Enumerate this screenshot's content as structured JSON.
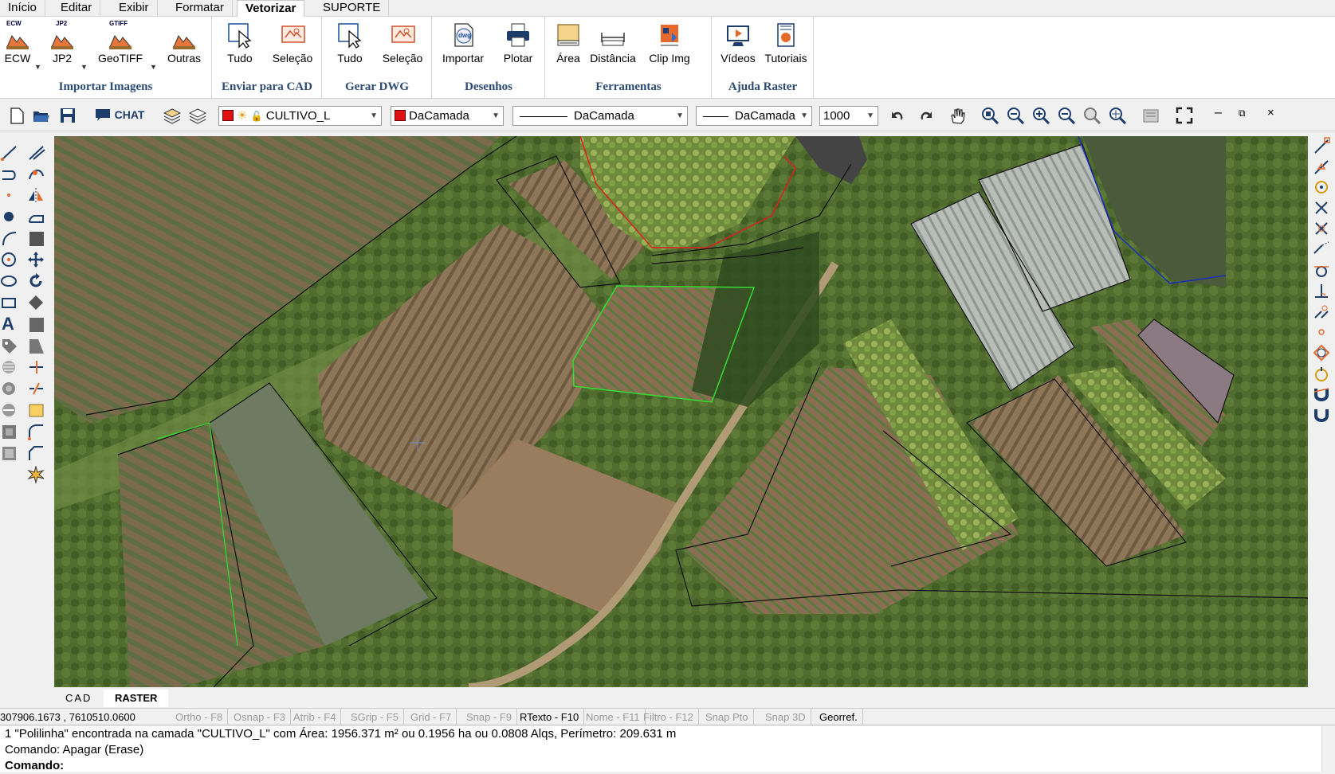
{
  "menu": {
    "tabs": [
      {
        "label": "Início"
      },
      {
        "label": "Editar"
      },
      {
        "label": "Exibir"
      },
      {
        "label": "Formatar"
      },
      {
        "label": "Vetorizar"
      },
      {
        "label": "SUPORTE"
      }
    ],
    "active_tab": "Vetorizar"
  },
  "ribbon": {
    "groups": [
      {
        "title": "Importar Imagens",
        "buttons": [
          {
            "label": "ECW",
            "badge": "ECW",
            "icon": "ecw-import-icon"
          },
          {
            "label": "JP2",
            "badge": "JP2",
            "icon": "jp2-import-icon"
          },
          {
            "label": "GeoTIFF",
            "badge": "GTIFF",
            "icon": "geotiff-import-icon"
          },
          {
            "label": "Outras",
            "icon": "other-image-import-icon"
          }
        ]
      },
      {
        "title": "Enviar para CAD",
        "buttons": [
          {
            "label": "Tudo",
            "icon": "send-all-icon"
          },
          {
            "label": "Seleção",
            "icon": "send-selection-icon"
          }
        ]
      },
      {
        "title": "Gerar DWG",
        "buttons": [
          {
            "label": "Tudo",
            "icon": "dwg-all-icon"
          },
          {
            "label": "Seleção",
            "icon": "dwg-selection-icon"
          }
        ]
      },
      {
        "title": "Desenhos",
        "buttons": [
          {
            "label": "Importar",
            "badge": "dwg",
            "icon": "import-dwg-icon"
          },
          {
            "label": "Plotar",
            "icon": "printer-icon"
          }
        ]
      },
      {
        "title": "Ferramentas",
        "buttons": [
          {
            "label": "Área",
            "icon": "area-icon"
          },
          {
            "label": "Distância",
            "icon": "distance-icon"
          },
          {
            "label": "Clip Img",
            "icon": "clip-image-icon"
          }
        ]
      },
      {
        "title": "Ajuda Raster",
        "buttons": [
          {
            "label": "Vídeos",
            "icon": "video-icon"
          },
          {
            "label": "Tutoriais",
            "icon": "tutorials-icon"
          }
        ]
      }
    ]
  },
  "toolbar": {
    "chat_label": "CHAT",
    "layer": "CULTIVO_L",
    "color": "DaCamada",
    "linetype": "DaCamada",
    "lineweight": "DaCamada",
    "scale": "1000"
  },
  "view_tabs": [
    {
      "label": "CAD"
    },
    {
      "label": "RASTER"
    }
  ],
  "active_view_tab": "RASTER",
  "status": {
    "coordinates": "307906.1673 , 7610510.0600",
    "toggles": [
      {
        "label": "Ortho - F8",
        "on": false
      },
      {
        "label": "Osnap - F3",
        "on": false
      },
      {
        "label": "Atrib - F4",
        "on": false
      },
      {
        "label": "SGrip - F5",
        "on": false
      },
      {
        "label": "Grid - F7",
        "on": false
      },
      {
        "label": "Snap - F9",
        "on": false
      },
      {
        "label": "RTexto - F10",
        "on": true
      },
      {
        "label": "Nome - F11",
        "on": false
      },
      {
        "label": "Filtro - F12",
        "on": false
      },
      {
        "label": "Snap Pto",
        "on": false
      },
      {
        "label": "Snap 3D",
        "on": false
      },
      {
        "label": "Georref.",
        "on": true
      }
    ]
  },
  "command": {
    "line1": " 1 \"Polilinha\" encontrada na camada \"CULTIVO_L\" com  Área: 1956.371 m² ou 0.1956 ha ou 0.0808 Alqs, Perímetro: 209.631 m",
    "line2": "Comando: Apagar (Erase)",
    "line3": "Comando:"
  },
  "colors": {
    "group_title": "#2b4a74",
    "layer_color": "#e01010",
    "selected_polygon": "#33dd33",
    "boundary": "#111111",
    "red_boundary": "#e02020",
    "blue_boundary": "#1a2fc0"
  }
}
